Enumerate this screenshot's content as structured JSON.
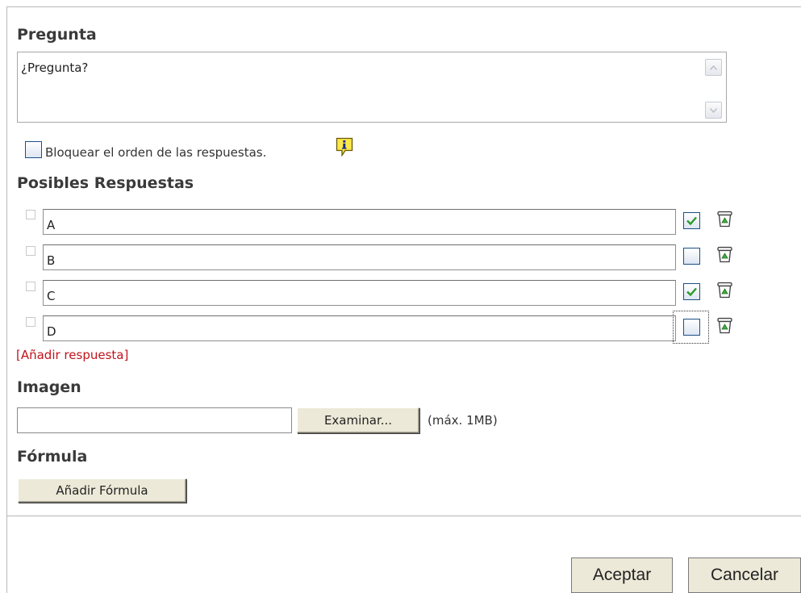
{
  "question": {
    "title": "Pregunta",
    "text": "¿Pregunta?"
  },
  "lock_order": {
    "checked": false,
    "label": "Bloquear el orden de las respuestas."
  },
  "answers": {
    "title": "Posibles Respuestas",
    "items": [
      {
        "text": "A",
        "correct": true
      },
      {
        "text": "B",
        "correct": false
      },
      {
        "text": "C",
        "correct": true
      },
      {
        "text": "D",
        "correct": false
      }
    ],
    "add_link": "[Añadir respuesta]"
  },
  "image": {
    "title": "Imagen",
    "file_value": "",
    "browse_label": "Examinar...",
    "max_note": "(máx. 1MB)"
  },
  "formula": {
    "title": "Fórmula",
    "add_label": "Añadir Fórmula"
  },
  "dialog": {
    "accept_label": "Aceptar",
    "cancel_label": "Cancelar"
  },
  "colors": {
    "link": "#c0141c",
    "check_mark": "#2a9a2a",
    "button_face": "#ece9d8"
  },
  "icons": {
    "info": "info-icon",
    "delete": "trash-icon",
    "check": "checkmark-icon"
  }
}
